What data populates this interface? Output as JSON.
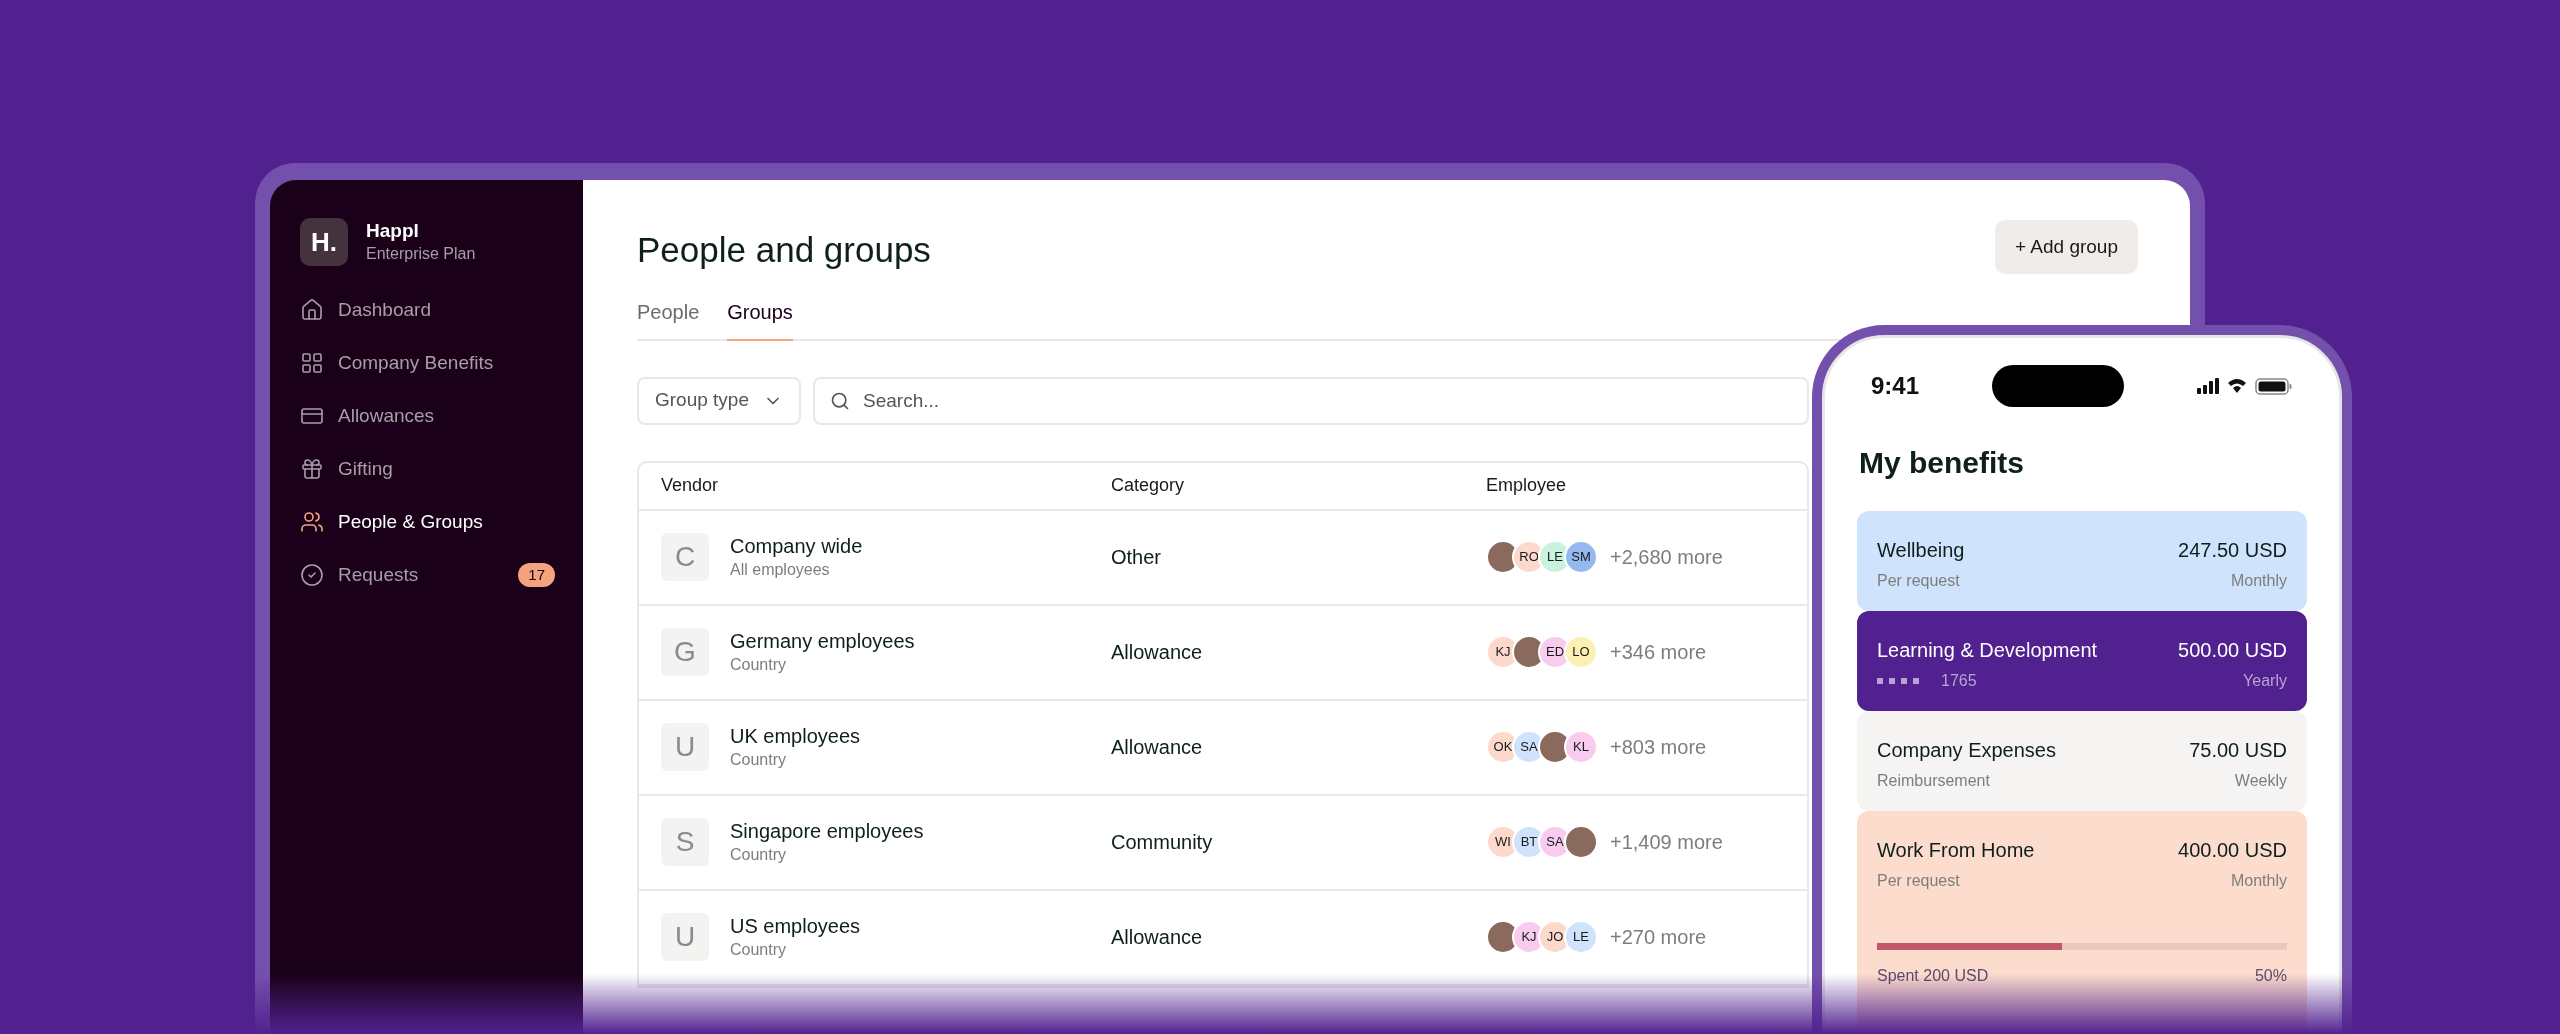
{
  "sidebar": {
    "logo": "H.",
    "brand": "Happl",
    "plan": "Enterprise Plan",
    "items": [
      {
        "label": "Dashboard",
        "selected": false
      },
      {
        "label": "Company Benefits",
        "selected": false
      },
      {
        "label": "Allowances",
        "selected": false
      },
      {
        "label": "Gifting",
        "selected": false
      },
      {
        "label": "People & Groups",
        "selected": true
      },
      {
        "label": "Requests",
        "selected": false,
        "badge": "17"
      }
    ]
  },
  "page": {
    "title": "People and groups",
    "add_button": "+ Add group"
  },
  "tabs": [
    {
      "label": "People",
      "selected": false
    },
    {
      "label": "Groups",
      "selected": true
    }
  ],
  "filters": {
    "group_type": "Group type",
    "search_placeholder": "Search..."
  },
  "table": {
    "columns": [
      "Vendor",
      "Category",
      "Employee"
    ],
    "rows": [
      {
        "letter": "C",
        "name": "Company wide",
        "subtitle": "All employees",
        "category": "Other",
        "avatars": [
          {
            "kind": "photo"
          },
          {
            "kind": "initials",
            "text": "RO",
            "color": "#fcd9cb"
          },
          {
            "kind": "initials",
            "text": "LE",
            "color": "#c9f2df"
          },
          {
            "kind": "initials",
            "text": "SM",
            "color": "#93b9ee"
          }
        ],
        "more": "+2,680 more"
      },
      {
        "letter": "G",
        "name": "Germany employees",
        "subtitle": "Country",
        "category": "Allowance",
        "avatars": [
          {
            "kind": "initials",
            "text": "KJ",
            "color": "#fcd9cb"
          },
          {
            "kind": "photo"
          },
          {
            "kind": "initials",
            "text": "ED",
            "color": "#f9ccef"
          },
          {
            "kind": "initials",
            "text": "LO",
            "color": "#fdf0b4"
          }
        ],
        "more": "+346 more"
      },
      {
        "letter": "U",
        "name": "UK employees",
        "subtitle": "Country",
        "category": "Allowance",
        "avatars": [
          {
            "kind": "initials",
            "text": "OK",
            "color": "#fcd9cb"
          },
          {
            "kind": "initials",
            "text": "SA",
            "color": "#cfe3fc"
          },
          {
            "kind": "photo"
          },
          {
            "kind": "initials",
            "text": "KL",
            "color": "#f9ccef"
          }
        ],
        "more": "+803 more"
      },
      {
        "letter": "S",
        "name": "Singapore employees",
        "subtitle": "Country",
        "category": "Community",
        "avatars": [
          {
            "kind": "initials",
            "text": "WI",
            "color": "#fcd9cb"
          },
          {
            "kind": "initials",
            "text": "BT",
            "color": "#cfe3fc"
          },
          {
            "kind": "initials",
            "text": "SA",
            "color": "#f9ccef"
          },
          {
            "kind": "photo"
          }
        ],
        "more": "+1,409 more"
      },
      {
        "letter": "U",
        "name": "US employees",
        "subtitle": "Country",
        "category": "Allowance",
        "avatars": [
          {
            "kind": "photo"
          },
          {
            "kind": "initials",
            "text": "KJ",
            "color": "#f9ccef"
          },
          {
            "kind": "initials",
            "text": "JO",
            "color": "#fcd9cb"
          },
          {
            "kind": "initials",
            "text": "LE",
            "color": "#cfe3fc"
          }
        ],
        "more": "+270 more"
      }
    ]
  },
  "phone": {
    "time": "9:41",
    "title": "My benefits",
    "cards": [
      {
        "kind": "plain",
        "name": "Wellbeing",
        "detail": "Per request",
        "amount": "247.50 USD",
        "period": "Monthly",
        "color": "#cfe3fc"
      },
      {
        "kind": "card",
        "name": "Learning & Development",
        "detail": "1765",
        "amount": "500.00 USD",
        "period": "Yearly",
        "color": "#51218f"
      },
      {
        "kind": "plain",
        "name": "Company Expenses",
        "detail": "Reimbursement",
        "amount": "75.00 USD",
        "period": "Weekly",
        "color": "#f5f4f3"
      },
      {
        "kind": "progress",
        "name": "Work From Home",
        "detail": "Per request",
        "amount": "400.00 USD",
        "period": "Monthly",
        "color": "#fcdccc",
        "level": 0.45,
        "spent": "Spent 200 USD",
        "percent": "50%"
      }
    ]
  }
}
